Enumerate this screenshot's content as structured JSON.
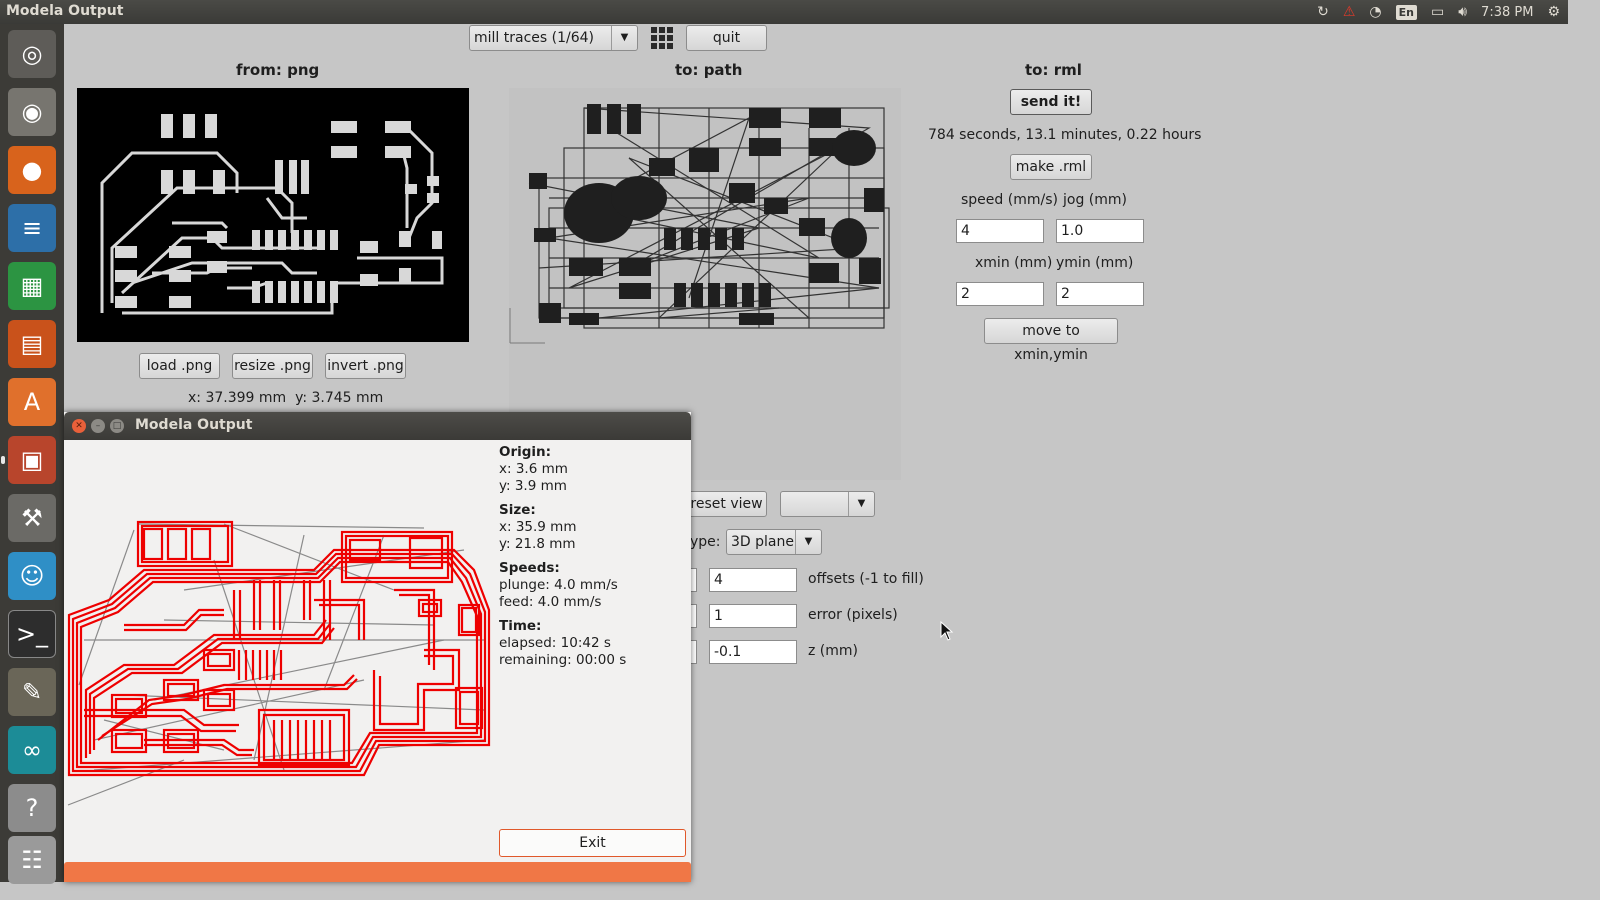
{
  "topbar": {
    "title": "Modela Output",
    "input_indicator": "En",
    "clock": "7:38 PM",
    "icons": [
      "sync-icon",
      "warning-icon",
      "wifi-icon",
      "keyboard-indicator-icon",
      "battery-icon",
      "volume-icon",
      "gear-icon"
    ]
  },
  "launcher": {
    "icons": [
      "ubuntu-dash-icon",
      "camera-icon",
      "firefox-icon",
      "writer-icon",
      "calc-icon",
      "impress-icon",
      "software-center-icon",
      "files-icon",
      "settings-icon",
      "chat-icon",
      "terminal-icon",
      "gimp-icon",
      "arduino-icon",
      "help-icon",
      "trash-icon"
    ]
  },
  "toolbar": {
    "process": "mill traces (1/64)",
    "quit": "quit"
  },
  "png_panel": {
    "header": "from: png",
    "load": "load .png",
    "resize": "resize .png",
    "invert": "invert .png",
    "coords": "x: 37.399 mm  y: 3.745 mm"
  },
  "path_panel": {
    "header": "to: path",
    "reset_view": "reset view",
    "type_label": "ype:",
    "type_value": "3D plane",
    "offsets_value": "4",
    "offsets_label": "offsets (-1 to fill)",
    "error_value": "1",
    "error_label": "error (pixels)",
    "z_value": "-0.1",
    "z_label": "z (mm)"
  },
  "rml_panel": {
    "header": "to: rml",
    "send": "send it!",
    "time_estimate": "784 seconds, 13.1 minutes, 0.22 hours",
    "make": "make .rml",
    "speed_label": "speed (mm/s)",
    "jog_label": "jog (mm)",
    "speed_value": "4",
    "jog_value": "1.0",
    "xmin_label": "xmin (mm)",
    "ymin_label": "ymin (mm)",
    "xmin_value": "2",
    "ymin_value": "2",
    "move": "move to xmin,ymin"
  },
  "dialog": {
    "title": "Modela Output",
    "origin_h": "Origin:",
    "origin_x": "x: 3.6 mm",
    "origin_y": "y: 3.9 mm",
    "size_h": "Size:",
    "size_x": "x: 35.9 mm",
    "size_y": "y: 21.8 mm",
    "speeds_h": "Speeds:",
    "plunge": "plunge: 4.0 mm/s",
    "feed": "feed: 4.0 mm/s",
    "time_h": "Time:",
    "elapsed": "elapsed: 10:42 s",
    "remaining": "remaining: 00:00 s",
    "exit": "Exit",
    "progress": 1.0,
    "trace_color": "#ee0000"
  }
}
